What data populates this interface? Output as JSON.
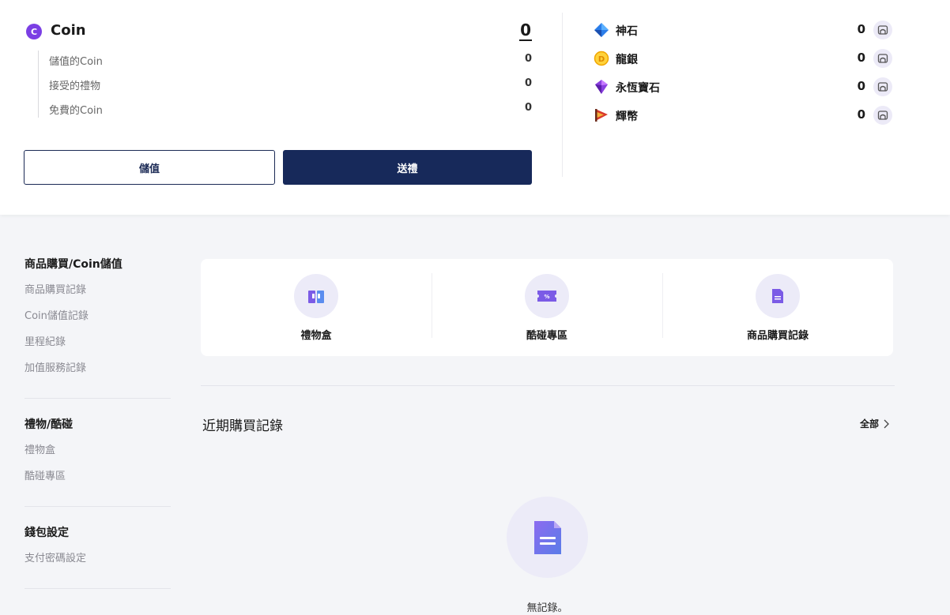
{
  "coin": {
    "title": "Coin",
    "icon_letter": "C",
    "total": "0",
    "breakdown": [
      {
        "label": "儲值的Coin",
        "value": "0"
      },
      {
        "label": "接受的禮物",
        "value": "0"
      },
      {
        "label": "免費的Coin",
        "value": "0"
      }
    ],
    "charge_label": "儲值",
    "gift_label": "送禮"
  },
  "currencies": [
    {
      "name": "神石",
      "value": "0",
      "icon": "blue-diamond-icon"
    },
    {
      "name": "龍銀",
      "value": "0",
      "icon": "gold-coin-icon"
    },
    {
      "name": "永恆寶石",
      "value": "0",
      "icon": "purple-gem-icon"
    },
    {
      "name": "輝幣",
      "value": "0",
      "icon": "red-flag-icon"
    }
  ],
  "sidebar": {
    "sections": [
      {
        "title": "商品購買/Coin儲值",
        "items": [
          "商品購買記錄",
          "Coin儲值記錄",
          "里程紀錄",
          "加值服務記錄"
        ]
      },
      {
        "title": "禮物/酷碰",
        "items": [
          "禮物盒",
          "酷碰專區"
        ]
      },
      {
        "title": "錢包設定",
        "items": [
          "支付密碼設定"
        ]
      }
    ]
  },
  "shortcuts": [
    {
      "label": "禮物盒",
      "icon": "gift-box-icon"
    },
    {
      "label": "酷碰專區",
      "icon": "coupon-icon"
    },
    {
      "label": "商品購買記錄",
      "icon": "document-icon"
    }
  ],
  "recent": {
    "title": "近期購買記錄",
    "view_all": "全部",
    "empty_text": "無記錄。"
  },
  "colors": {
    "accent": "#7b3fe4",
    "navy": "#17295a",
    "icon_bg": "#ecebf8"
  }
}
